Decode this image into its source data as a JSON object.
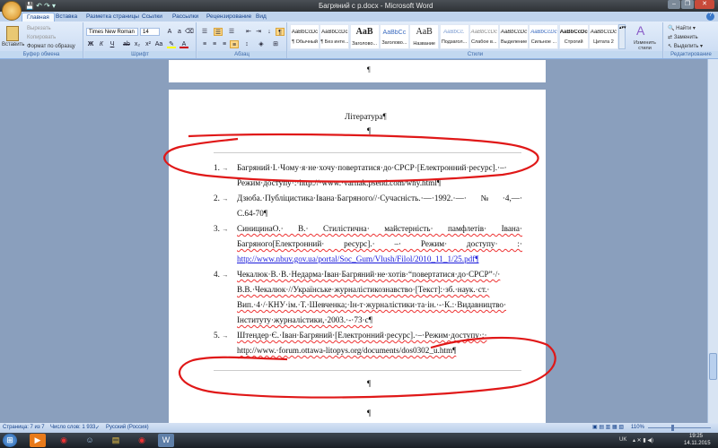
{
  "window": {
    "title": "Багряний с р.docx - Microsoft Word"
  },
  "tabs": [
    "Главная",
    "Вставка",
    "Разметка страницы",
    "Ссылки",
    "Рассылки",
    "Рецензирование",
    "Вид"
  ],
  "clipboard": {
    "paste": "Вставить",
    "cut": "Вырезать",
    "copy": "Копировать",
    "format_painter": "Формат по образцу",
    "label": "Буфер обмена"
  },
  "font": {
    "name": "Times New Roman",
    "size": "14",
    "label": "Шрифт"
  },
  "paragraph": {
    "label": "Абзац"
  },
  "styles": {
    "label": "Стили",
    "items": [
      {
        "sample": "AaBbCcDc",
        "name": "¶ Обычный"
      },
      {
        "sample": "AaBbCcDc",
        "name": "¶ Без инте..."
      },
      {
        "sample": "AaB",
        "name": "Заголово..."
      },
      {
        "sample": "AaBbCc",
        "name": "Заголово..."
      },
      {
        "sample": "AaB",
        "name": "Название"
      },
      {
        "sample": "AaBbCc.",
        "name": "Подзагол..."
      },
      {
        "sample": "AaBbCcDc",
        "name": "Слабое в..."
      },
      {
        "sample": "AaBbCcDc",
        "name": "Выделение"
      },
      {
        "sample": "AaBbCcDc",
        "name": "Сильное ..."
      },
      {
        "sample": "AaBbCcDc",
        "name": "Строгий"
      },
      {
        "sample": "AaBbCcDc",
        "name": "Цитата 2"
      }
    ],
    "change": "Изменить стили"
  },
  "editing": {
    "find": "Найти",
    "replace": "Заменить",
    "select": "Выделить",
    "label": "Редактирование"
  },
  "document": {
    "heading": "Література¶",
    "pilcrow": "¶",
    "items": [
      {
        "num": "1.",
        "lines": [
          "Багряний·І.·Чому·я·не·хочу·повертатися·до·СРСР·[Електронний·ресурс].·–·",
          "Режим·доступу·:·http://·www.·varnak.psend.com/why.html¶"
        ]
      },
      {
        "num": "2.",
        "lines": [
          "Дзюба.·Публіцистика·Івана·Багряного//·Сучасність.·—·1992.·—·№·4,—·",
          "С.64-70¶"
        ]
      },
      {
        "num": "3.",
        "lines": [
          "СиницинаО.·   В.·   Стилістична·   майстерність·   памфлетів·   Івана·",
          "Багряного[Електронний·    ресурс].·     –·     Режим·     доступу·     :·",
          "http://www.nbuv.gov.ua/portal/Soc_Gum/Vlush/Filol/2010_11_1/25.pdf¶"
        ]
      },
      {
        "num": "4.",
        "lines": [
          "Чекалюк·В.·В.·Недарма·Іван·Багряний·не·хотів·“повертатися·до·СРСР”·/·",
          "В.В.·Чекалюк·//Українське·журналістикознавство·[Текст]:·зб.·наук.·ст.·",
          "Вип.·4·/·КНУ·ім.·Т.·Шевченка;·Ін-т·журналістики·та·ін.·-·К.:·Видавництво·",
          "Інституту·журналістики,·2003.·-·73·с¶"
        ]
      },
      {
        "num": "5.",
        "lines": [
          "Штендер·Є.·Іван·Багряний·[Електронний·ресурс].·–·Режим·доступу·:·",
          "http://www.·forum.ottawa-litopys.org/documents/dos0302_u.htm¶"
        ]
      }
    ],
    "trail": [
      "¶",
      "¶"
    ]
  },
  "status": {
    "page": "Страница: 7 из 7",
    "words": "Число слов: 1 933",
    "language": "Русский (Россия)",
    "zoom": "110%",
    "zoom_percent": 110
  },
  "taskbar": {
    "lang": "UK",
    "time": "19:25",
    "date": "14.11.2015"
  },
  "colors": {
    "annotation": "#e01818",
    "link": "#1a1adb"
  }
}
